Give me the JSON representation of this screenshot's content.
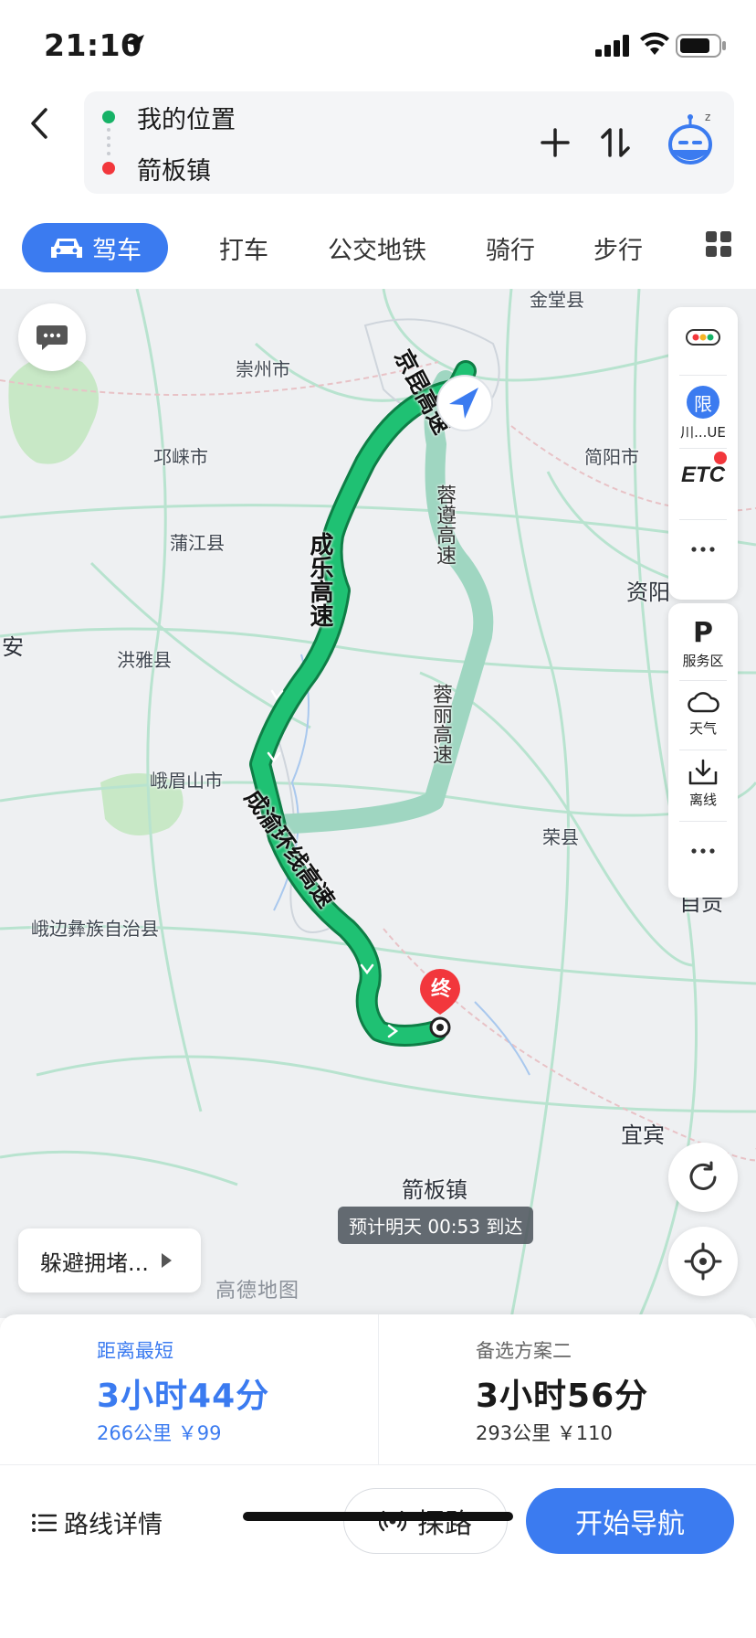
{
  "status_bar": {
    "time": "21:10"
  },
  "route": {
    "start": "我的位置",
    "end": "箭板镇"
  },
  "tabs": {
    "drive": "驾车",
    "taxi": "打车",
    "transit": "公交地铁",
    "bike": "骑行",
    "walk": "步行"
  },
  "map": {
    "places": {
      "jintang": "金堂县",
      "chongzhou": "崇州市",
      "qionglai": "邛崃市",
      "jianyang": "简阳市",
      "pujiang": "蒲江县",
      "ziyang": "资阳",
      "an": "安",
      "hongya": "洪雅县",
      "emeishan": "峨眉山市",
      "rongxian": "荣县",
      "zigong": "自贡",
      "ebian": "峨边彝族自治县",
      "yibin": "宜宾",
      "destination": "箭板镇"
    },
    "roads": {
      "jingkun": "京昆高速",
      "chengle": "成乐高速",
      "chengyu": "成渝环线高速",
      "rongzun": "蓉遵高速",
      "rongli": "蓉丽高速"
    },
    "end_marker": "终",
    "eta": "预计明天 00:53 到达",
    "logo": "高德地图",
    "avoid_label": "躲避拥堵...",
    "side_tools": {
      "restrict_badge": "限",
      "restrict_plate": "川...UE",
      "etc": "ETC",
      "service_area": "服务区",
      "weather": "天气",
      "offline": "离线",
      "service_icon": "P"
    }
  },
  "plans": [
    {
      "tag": "距离最短",
      "duration": "3小时44分",
      "meta": "266公里 ￥99"
    },
    {
      "tag": "备选方案二",
      "duration": "3小时56分",
      "meta": "293公里 ￥110"
    }
  ],
  "actions": {
    "details": "路线详情",
    "probe": "探路",
    "start_nav": "开始导航"
  },
  "colors": {
    "accent": "#3b7bf0",
    "route_main": "#18b26a",
    "route_alt": "#8fd0b8",
    "start_dot": "#17b267",
    "end_dot": "#f2373c"
  }
}
